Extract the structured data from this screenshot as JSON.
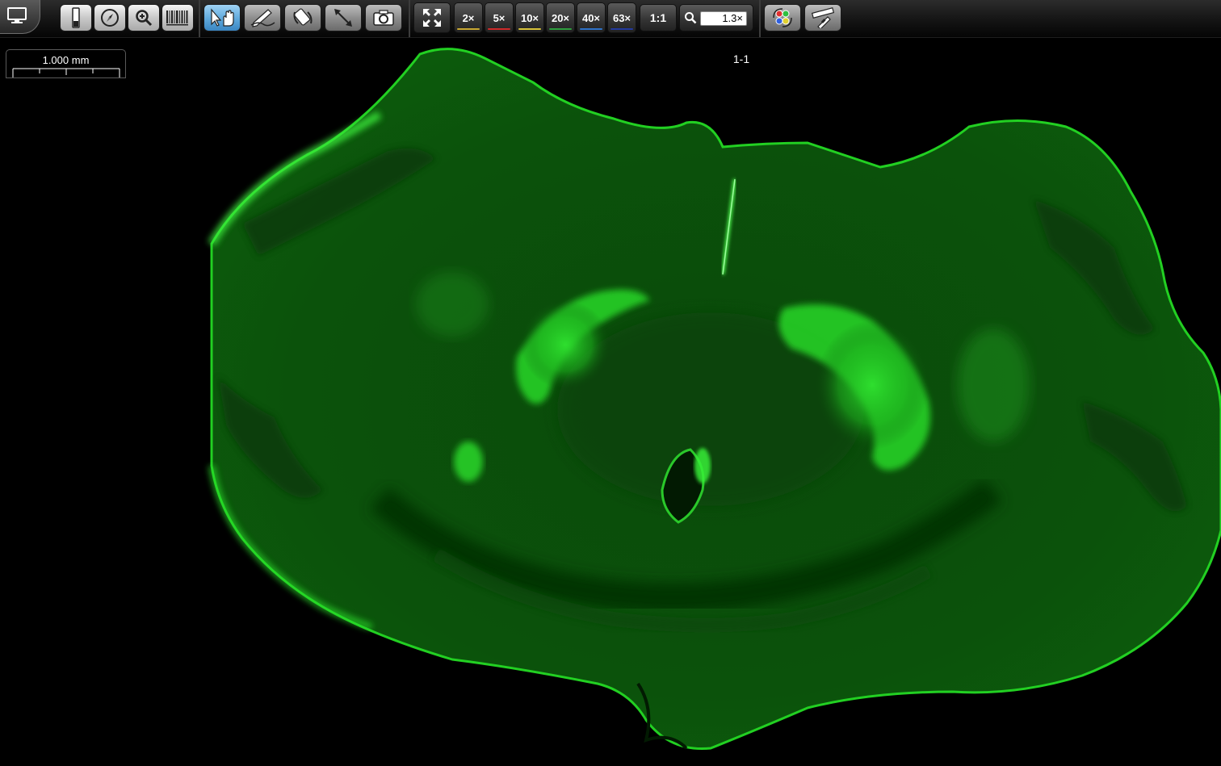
{
  "toolbar": {
    "app_menu_icon": "monitor-icon",
    "tools": [
      "slide-tray-icon",
      "navigator-compass-icon",
      "magnifier-icon",
      "barcode-icon"
    ],
    "interaction_tools": [
      {
        "icon": "pointer-hand-icon",
        "active": true
      },
      {
        "icon": "annotation-pen-icon",
        "active": false
      },
      {
        "icon": "rotate-icon",
        "active": false
      },
      {
        "icon": "measure-icon",
        "active": false
      },
      {
        "icon": "camera-icon",
        "active": false
      }
    ],
    "fit_icon": "fit-to-screen-icon",
    "zoom_levels": [
      {
        "label": "2×",
        "color": "#c8a832"
      },
      {
        "label": "5×",
        "color": "#d02a2a"
      },
      {
        "label": "10×",
        "color": "#d8c23a"
      },
      {
        "label": "20×",
        "color": "#2e9e3e"
      },
      {
        "label": "40×",
        "color": "#2f72c8"
      },
      {
        "label": "63×",
        "color": "#233a9e"
      }
    ],
    "ratio_label": "1:1",
    "zoom_search_icon": "search-icon",
    "zoom_value": "1.3×",
    "right_tools": [
      "color-channels-icon",
      "ruler-calibration-icon"
    ]
  },
  "scale_bar": {
    "label": "1.000 mm"
  },
  "slide_label": "1-1",
  "viewer": {
    "image": "fluorescent-brain-section",
    "stain_color": "#00d000"
  }
}
